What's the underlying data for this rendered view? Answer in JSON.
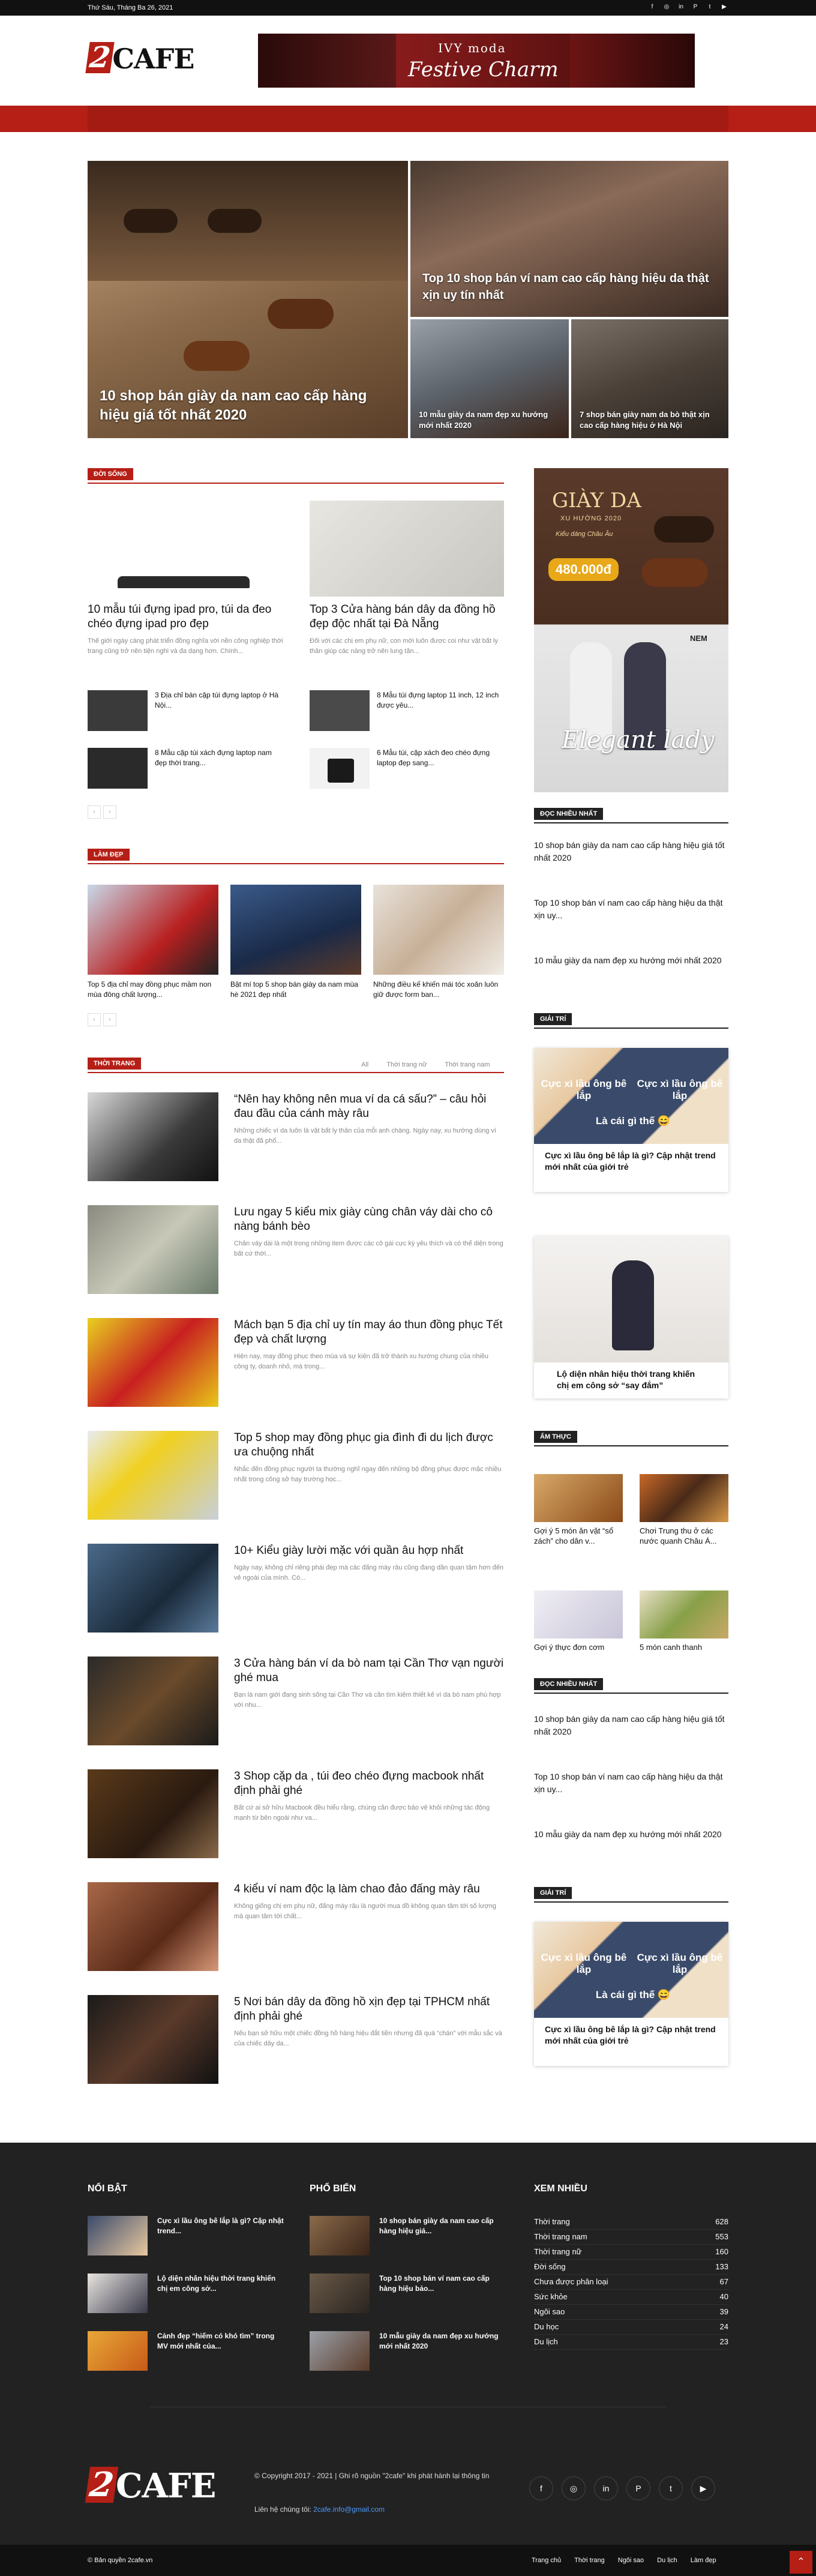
{
  "topbar": {
    "date": "Thứ Sáu, Tháng Ba 26, 2021"
  },
  "social_icons": [
    "facebook-icon",
    "instagram-icon",
    "linkedin-icon",
    "pinterest-icon",
    "twitter-icon",
    "youtube-icon"
  ],
  "logo": {
    "mark": "2",
    "text": "CAFE"
  },
  "banner": {
    "brand": "IVY moda",
    "headline": "Festive Charm"
  },
  "hero": {
    "main": "10 shop bán giày da nam cao cấp hàng hiệu giá tốt nhất 2020",
    "top_right": "Top 10 shop bán ví nam cao cấp hàng hiệu da thật xịn uy tín nhất",
    "bottom_left": "10 mẫu giày da nam đẹp xu hướng mới nhất 2020",
    "bottom_right": "7 shop bán giày nam da bò thật xịn cao cấp hàng hiệu ở Hà Nội"
  },
  "doi_song": {
    "title": "ĐỜI SỐNG",
    "lead": [
      {
        "title": "10 mẫu túi đựng ipad pro, túi da đeo chéo đựng ipad pro đẹp",
        "excerpt": "Thế giới ngày càng phát triển đồng nghĩa với nền công nghiệp thời trang cũng trở nên tiện nghi và đa dạng hơn. Chính..."
      },
      {
        "title": "Top 3 Cửa hàng bán dây da đồng hồ đẹp độc nhất tại Đà Nẵng",
        "excerpt": "Đối với các chị em phụ nữ, con mới luôn được coi như vật bất ly thân giúp các nàng trở nên lung tăn..."
      }
    ],
    "small": [
      "3 Địa chỉ bán cặp túi đựng laptop ở Hà Nội...",
      "8 Mẫu túi đựng laptop 11 inch, 12 inch được yêu...",
      "8 Mẫu cặp túi xách đựng laptop nam đẹp thời trang...",
      "6 Mẫu túi, cặp xách đeo chéo đựng laptop đẹp sang..."
    ]
  },
  "lam_dep": {
    "title": "LÀM ĐẸP",
    "items": [
      "Top 5 địa chỉ may đồng phục mầm non mùa đông chất lượng...",
      "Bật mí top 5 shop bán giày da nam mùa hè 2021 đẹp nhất",
      "Những điều kế khiến mái tóc xoăn luôn giữ được form ban..."
    ]
  },
  "thoi_trang": {
    "title": "THỜI TRANG",
    "tabs": [
      "All",
      "Thời trang nữ",
      "Thời trang nam"
    ],
    "posts": [
      {
        "title": "“Nên hay không nên mua ví da cá sấu?” – câu hỏi đau đầu của cánh mày râu",
        "excerpt": "Những chiếc ví da luôn là vật bất ly thân của mỗi anh chàng. Ngày nay, xu hướng dùng ví da thật đã phổ..."
      },
      {
        "title": "Lưu ngay 5 kiểu mix giày cùng chân váy dài cho cô nàng bánh bèo",
        "excerpt": "Chân váy dài là một trong những item được các cô gái cực kỳ yêu thích và có thể diện trong bất cứ thời..."
      },
      {
        "title": "Mách bạn 5 địa chỉ uy tín may áo thun đồng phục Tết đẹp và chất lượng",
        "excerpt": "Hiện nay, may đồng phục theo mùa và sự kiện đã trở thành xu hướng chung của nhiều công ty, doanh nhỏ, mà trong..."
      },
      {
        "title": "Top 5 shop may đồng phục gia đình đi du lịch được ưa chuộng nhất",
        "excerpt": "Nhắc đến đồng phục người ta thường nghĩ ngay đến những bộ đồng phục được mặc nhiều nhất trong công sở hay trường học..."
      },
      {
        "title": "10+ Kiểu giày lười mặc với quần âu hợp nhất",
        "excerpt": "Ngày nay, không chỉ riêng phái đẹp mà các đấng mày râu cũng đang dần quan tâm hơn đến vẻ ngoài của mình. Có..."
      },
      {
        "title": "3 Cửa hàng bán ví da bò nam tại Cần Thơ vạn người ghé mua",
        "excerpt": "Bạn là nam giới đang sinh sống tại Cần Thơ và cần tìm kiếm thiết kế ví da bò nam phù hợp với nhu..."
      },
      {
        "title": "3 Shop cặp da , túi đeo chéo đựng macbook nhất định phải ghé",
        "excerpt": "Bất cứ ai sở hữu Macbook đều hiểu rằng, chúng cần được bảo vệ khỏi những tác động mạnh từ bên ngoài như va..."
      },
      {
        "title": "4 kiểu ví nam độc lạ làm chao đảo đấng mày râu",
        "excerpt": "Không giống chị em phụ nữ, đấng mày râu là người mua đồ không quan tâm tới số lượng mà quan tâm tới chất..."
      },
      {
        "title": "5 Nơi bán dây da đồng hồ xịn đẹp tại TPHCM nhất định phải ghé",
        "excerpt": "Nếu bạn sở hữu một chiếc đồng hồ hàng hiệu đắt tiền nhưng đã quá “chán” với mẫu sắc và của chiếc dây da..."
      }
    ]
  },
  "sidebar": {
    "ad": {
      "title": "GIÀY DA",
      "sub": "XU HƯỚNG 2020",
      "style": "Kiểu dáng Châu Âu",
      "price": "480.000đ",
      "brand": "NEM",
      "script": "Elegant lady"
    },
    "doc_nhieu_title": "ĐỌC NHIỀU NHẤT",
    "doc_nhieu": [
      "10 shop bán giày da nam cao cấp hàng hiệu giá tốt nhất 2020",
      "Top 10 shop bán ví nam cao cấp hàng hiệu da thật xịn uy...",
      "10 mẫu giày da nam đẹp xu hướng mới nhất 2020"
    ],
    "giai_tri_title": "GIẢI TRÍ",
    "giai_tri": [
      {
        "overlay": "Cực xì lầu ông bê lắp",
        "overlay2": "Là cái gì thế 😄",
        "title": "Cực xì lầu ông bê lắp là gì? Cập nhật trend mới nhất của giới trẻ"
      },
      {
        "title": "Lộ diện nhân hiệu thời trang khiến chị em công sở “say đắm”"
      }
    ],
    "am_thuc_title": "ẨM THỰC",
    "am_thuc": [
      "Gợi ý 5 món ăn vặt “sổ zách” cho dân v...",
      "Chơi Trung thu ở các nước quanh Châu Á...",
      "Gợi ý thực đơn cơm",
      "5 món canh thanh"
    ],
    "doc_nhieu2_title": "ĐỌC NHIỀU NHẤT",
    "giai_tri2_title": "GIẢI TRÍ"
  },
  "footer": {
    "noi_bat_title": "NỔI BẬT",
    "noi_bat": [
      "Cực xì lầu ông bê lắp là gì? Cập nhật trend...",
      "Lộ diện nhân hiệu thời trang khiến chị em công sở...",
      "Cảnh đẹp “hiếm có khó tìm” trong MV mới nhất của..."
    ],
    "pho_bien_title": "PHỔ BIẾN",
    "pho_bien": [
      "10 shop bán giày da nam cao cấp hàng hiệu giá...",
      "Top 10 shop bán ví nam cao cấp hàng hiệu bảo...",
      "10 mẫu giày da nam đẹp xu hướng mới nhất 2020"
    ],
    "xem_nhieu_title": "XEM NHIỀU",
    "categories": [
      {
        "name": "Thời trang",
        "count": "628"
      },
      {
        "name": "Thời trang nam",
        "count": "553"
      },
      {
        "name": "Thời trang nữ",
        "count": "160"
      },
      {
        "name": "Đời sống",
        "count": "133"
      },
      {
        "name": "Chưa được phân loại",
        "count": "67"
      },
      {
        "name": "Sức khỏe",
        "count": "40"
      },
      {
        "name": "Ngôi sao",
        "count": "39"
      },
      {
        "name": "Du học",
        "count": "24"
      },
      {
        "name": "Du lịch",
        "count": "23"
      }
    ],
    "copyright": "© Copyright 2017 - 2021 | Ghi rõ nguồn \"2cafe\" khi phát hành lại thông tin",
    "contact_label": "Liên hệ chúng tôi:",
    "contact_email": "2cafe.info@gmail.com",
    "bottom_copy": "© Bản quyền 2cafe.vn",
    "bottom_links": [
      "Trang chủ",
      "Thời trang",
      "Ngôi sao",
      "Du lịch",
      "Làm đẹp"
    ]
  },
  "colors": {
    "accent": "#b51f16",
    "dark": "#222222"
  }
}
